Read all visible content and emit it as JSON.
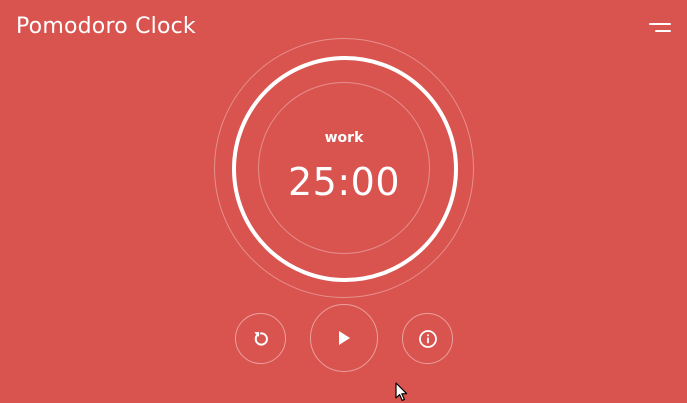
{
  "app": {
    "title": "Pomodoro Clock"
  },
  "header": {
    "menu_icon": "hamburger-menu-icon"
  },
  "timer": {
    "session_label": "work",
    "time": "25:00",
    "progress": 1.0
  },
  "controls": {
    "reset_icon": "reset-icon",
    "play_icon": "play-icon",
    "info_icon": "info-icon"
  },
  "colors": {
    "background": "#d9534f",
    "foreground": "#ffffff",
    "ring_faint": "rgba(255,255,255,0.35)"
  }
}
